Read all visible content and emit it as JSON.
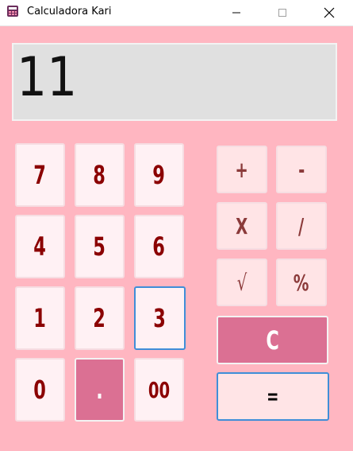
{
  "window": {
    "title": "Calculadora Kari",
    "icon": "calculator-app-icon",
    "controls": [
      "minimize-icon",
      "maximize-icon",
      "close-icon"
    ]
  },
  "display": {
    "value": "11"
  },
  "keys": {
    "k7": "7",
    "k8": "8",
    "k9": "9",
    "k4": "4",
    "k5": "5",
    "k6": "6",
    "k1": "1",
    "k2": "2",
    "k3": "3",
    "k0": "0",
    "dot": ".",
    "k00": "00",
    "plus": "+",
    "minus": "-",
    "times": "X",
    "divide": "/",
    "sqrt": "√",
    "percent": "%",
    "clear": "C",
    "equals": "="
  },
  "colors": {
    "background": "#ffb6c1",
    "key_text": "#8b0000",
    "accent_key": "#db7093",
    "focus_border": "#3f8ed8"
  }
}
